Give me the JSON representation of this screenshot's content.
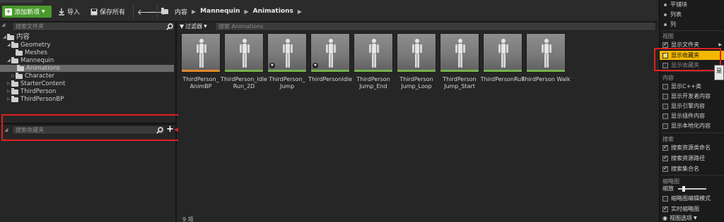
{
  "toolbar": {
    "add_new_label": "添加新项",
    "import_label": "导入",
    "save_all_label": "保存所有",
    "breadcrumb": [
      "内容",
      "Mannequin",
      "Animations"
    ]
  },
  "left_panel": {
    "folder_search_placeholder": "搜索文件夹",
    "tree": [
      {
        "label": "内容",
        "expanded": true
      },
      {
        "label": "Geometry",
        "expanded": true
      },
      {
        "label": "Meshes"
      },
      {
        "label": "Mannequin",
        "expanded": true
      },
      {
        "label": "Animations",
        "selected": true
      },
      {
        "label": "Character"
      },
      {
        "label": "StarterContent"
      },
      {
        "label": "ThirdPerson"
      },
      {
        "label": "ThirdPersonBP"
      }
    ],
    "collections_search_placeholder": "搜索收藏夹",
    "add_collection_label": "+"
  },
  "main": {
    "filters_label": "过滤器",
    "search_placeholder": "搜索 Animations",
    "assets": [
      {
        "name": "ThirdPerson_ AnimBP",
        "bar_color": "#e08a2c",
        "badge": ""
      },
      {
        "name": "ThirdPerson_Idle Run_2D",
        "bar_color": "#73b24a",
        "badge": ""
      },
      {
        "name": "ThirdPerson_ Jump",
        "bar_color": "#73b24a",
        "badge": "★"
      },
      {
        "name": "ThirdPersonIdle",
        "bar_color": "#73b24a",
        "badge": "★"
      },
      {
        "name": "ThirdPerson Jump_End",
        "bar_color": "#73b24a",
        "badge": ""
      },
      {
        "name": "ThirdPerson Jump_Loop",
        "bar_color": "#73b24a",
        "badge": ""
      },
      {
        "name": "ThirdPerson Jump_Start",
        "bar_color": "#73b24a",
        "badge": ""
      },
      {
        "name": "ThirdPersonRun",
        "bar_color": "#73b24a",
        "badge": ""
      },
      {
        "name": "ThirdPerson Walk",
        "bar_color": "#73b24a",
        "badge": ""
      }
    ],
    "item_count": "9 项"
  },
  "view_menu": {
    "view_type_items": [
      "平铺块",
      "列表",
      "列"
    ],
    "view_heading": "视图",
    "show_folders": "显示文件夹",
    "show_collections": "显示收藏夹",
    "show_favorites": "显示收藏夹",
    "content_heading": "内容",
    "content_items": [
      "显示C++类",
      "显示开发者内容",
      "显示引擎内容",
      "显示插件内容",
      "显示本地化内容"
    ],
    "search_heading": "搜索",
    "search_items": [
      "搜索资源类命名",
      "搜索资源路径",
      "搜索集合名"
    ],
    "thumbnail_heading": "缩略图",
    "zoom_label": "缩放",
    "thumbnail_edit_mode": "缩略图编辑模式",
    "realtime_thumbnails": "实时缩略图",
    "view_options_label": "视图选项",
    "tooltip_text": "是"
  }
}
